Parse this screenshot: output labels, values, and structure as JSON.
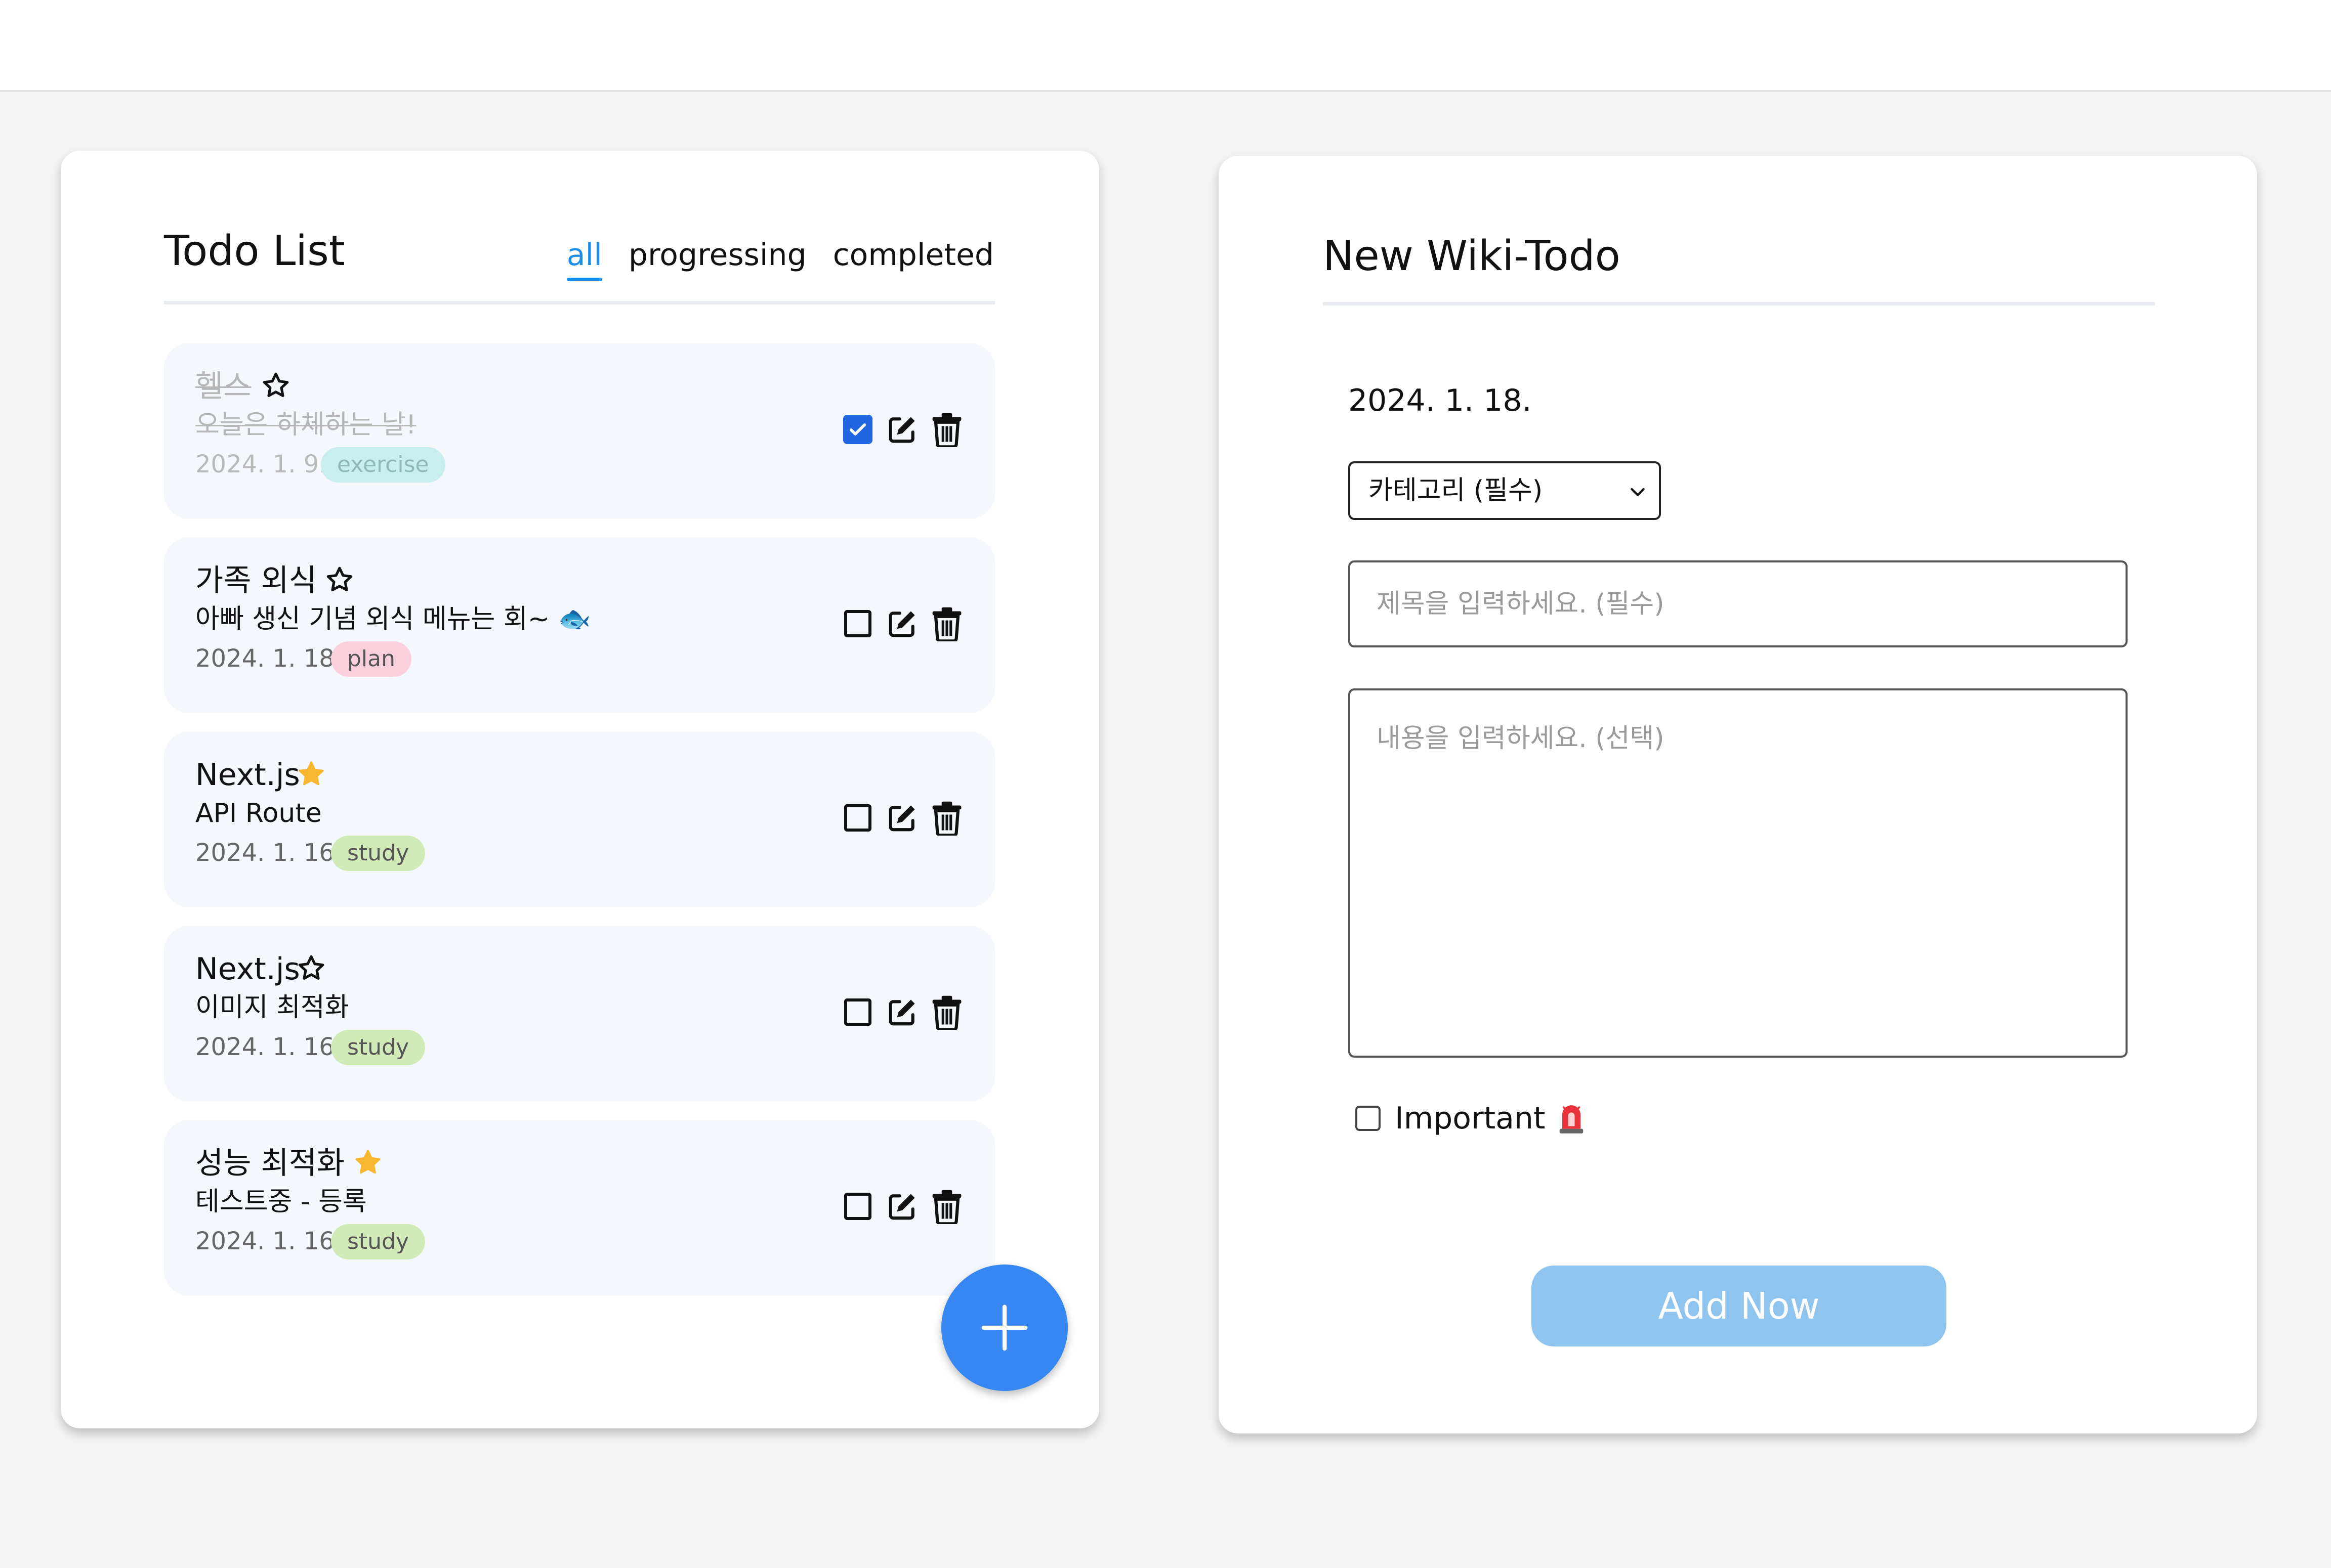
{
  "todo_list": {
    "title": "Todo List",
    "filters": [
      {
        "label": "all",
        "active": true
      },
      {
        "label": "progressing",
        "active": false
      },
      {
        "label": "completed",
        "active": false
      }
    ],
    "items": [
      {
        "title": "헬스",
        "desc": "오늘은 하체하는 날!",
        "date": "2024. 1. 9.",
        "tag": "exercise",
        "starred": false,
        "completed": true
      },
      {
        "title": "가족 외식",
        "desc": "아빠 생신 기념 외식 메뉴는 회~ 🐟",
        "date": "2024. 1. 18.",
        "tag": "plan",
        "starred": false,
        "completed": false
      },
      {
        "title": "Next.js",
        "desc": "API Route",
        "date": "2024. 1. 16.",
        "tag": "study",
        "starred": true,
        "completed": false
      },
      {
        "title": "Next.js",
        "desc": "이미지 최적화",
        "date": "2024. 1. 16.",
        "tag": "study",
        "starred": false,
        "completed": false
      },
      {
        "title": "성능 최적화",
        "desc": "테스트중 - 등록",
        "date": "2024. 1. 16.",
        "tag": "study",
        "starred": true,
        "completed": false
      }
    ],
    "fab_icon": "plus-icon"
  },
  "new_todo": {
    "title": "New Wiki-Todo",
    "date": "2024. 1. 18.",
    "category_select": "카테고리 (필수)",
    "title_placeholder": "제목을 입력하세요. (필수)",
    "content_placeholder": "내용을 입력하세요. (선택)",
    "important_label": "Important",
    "important_checked": false,
    "submit_label": "Add Now"
  },
  "colors": {
    "accent": "#1d8ee8",
    "fab": "#3687f2",
    "submit_disabled": "#8fc4ee",
    "star_filled": "#f7b731",
    "checked": "#1f66e0",
    "item_bg": "#f4f7fc",
    "tag_exercise": "#c9eef0",
    "tag_plan": "#fbd0dc",
    "tag_study": "#d0eab8"
  }
}
